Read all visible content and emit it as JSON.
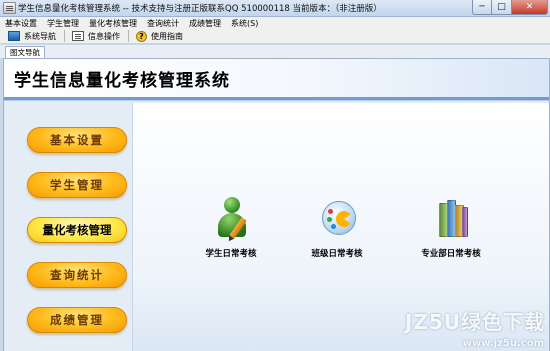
{
  "window": {
    "title": "学生信息量化考核管理系统 -- 技术支持与注册正版联系QQ 510000118    当前版本：（非注册版）",
    "minimize_label": "─",
    "maximize_label": "□",
    "close_label": "✕"
  },
  "menubar": {
    "items": [
      {
        "label": "基本设置"
      },
      {
        "label": "学生管理"
      },
      {
        "label": "量化考核管理"
      },
      {
        "label": "查询统计"
      },
      {
        "label": "成绩管理"
      },
      {
        "label": "系统(S)"
      }
    ]
  },
  "toolbar": {
    "nav_label": "系统导航",
    "info_label": "信息操作",
    "help_label": "使用指南",
    "help_glyph": "?"
  },
  "tabs": [
    {
      "label": "图文导航"
    }
  ],
  "header": {
    "title": "学生信息量化考核管理系统"
  },
  "nav": {
    "buttons": [
      {
        "label": "基本设置"
      },
      {
        "label": "学生管理"
      },
      {
        "label": "量化考核管理"
      },
      {
        "label": "查询统计"
      },
      {
        "label": "成绩管理"
      }
    ]
  },
  "functions": [
    {
      "label": "学生日常考核",
      "icon": "student-pencil-icon"
    },
    {
      "label": "班级日常考核",
      "icon": "class-palette-icon"
    },
    {
      "label": "专业部日常考核",
      "icon": "books-icon"
    }
  ],
  "watermark": {
    "text": "JZ5U绿色下载",
    "url": "www.jz5u.com"
  },
  "colors": {
    "nav_button": "#ffba1a",
    "nav_button_active": "#ffe84a",
    "header_bar": "#6f9bd6"
  }
}
